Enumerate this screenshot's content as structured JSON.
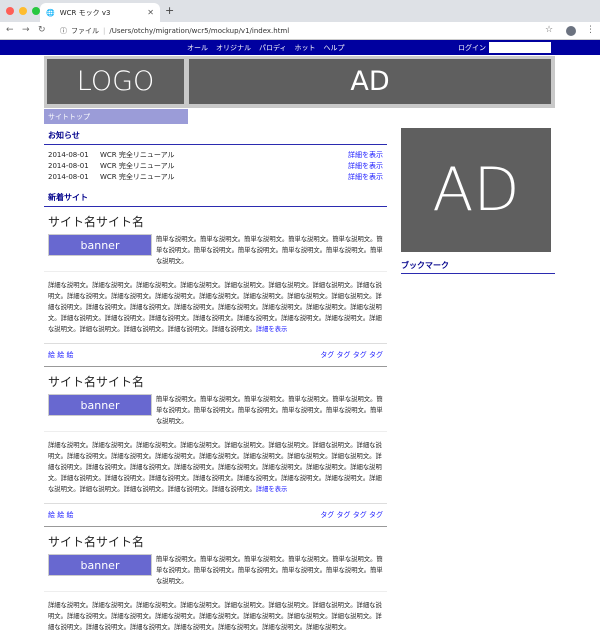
{
  "browser": {
    "tab_title": "WCR モック v3",
    "url_prefix": "ファイル",
    "url": "/Users/otchy/migration/wcr5/mockup/v1/index.html",
    "colors": {
      "red": "#ff5f57",
      "yellow": "#febc2e",
      "green": "#28c840"
    }
  },
  "nav": {
    "items": [
      "オール",
      "オリジナル",
      "パロディ",
      "ホット",
      "ヘルプ"
    ],
    "login": "ログイン"
  },
  "header": {
    "logo": "LOGO",
    "ad": "AD"
  },
  "breadcrumb": "サイトトップ",
  "news": {
    "title": "お知らせ",
    "rows": [
      {
        "date": "2014-08-01",
        "text": "WCR 完全リニューアル",
        "link": "詳細を表示"
      },
      {
        "date": "2014-08-01",
        "text": "WCR 完全リニューアル",
        "link": "詳細を表示"
      },
      {
        "date": "2014-08-01",
        "text": "WCR 完全リニューアル",
        "link": "詳細を表示"
      }
    ]
  },
  "new_sites": {
    "title": "新着サイト",
    "items": [
      {
        "name": "サイト名サイト名",
        "banner": "banner",
        "short": "簡単な説明文。簡単な説明文。簡単な説明文。簡単な説明文。簡単な説明文。簡単な説明文。簡単な説明文。簡単な説明文。簡単な説明文。簡単な説明文。簡単な説明文。",
        "long": "詳細な説明文。詳細な説明文。詳細な説明文。詳細な説明文。詳細な説明文。詳細な説明文。詳細な説明文。詳細な説明文。詳細な説明文。詳細な説明文。詳細な説明文。詳細な説明文。詳細な説明文。詳細な説明文。詳細な説明文。詳細な説明文。詳細な説明文。詳細な説明文。詳細な説明文。詳細な説明文。詳細な説明文。詳細な説明文。詳細な説明文。詳細な説明文。詳細な説明文。詳細な説明文。詳細な説明文。詳細な説明文。詳細な説明文。詳細な説明文。詳細な説明文。詳細な説明文。詳細な説明文。詳細な説明文。詳細な説明文。",
        "more": "詳細を表示",
        "pics": "絵 絵 絵",
        "tags": "タグ タグ タグ タグ"
      },
      {
        "name": "サイト名サイト名",
        "banner": "banner",
        "short": "簡単な説明文。簡単な説明文。簡単な説明文。簡単な説明文。簡単な説明文。簡単な説明文。簡単な説明文。簡単な説明文。簡単な説明文。簡単な説明文。簡単な説明文。",
        "long": "詳細な説明文。詳細な説明文。詳細な説明文。詳細な説明文。詳細な説明文。詳細な説明文。詳細な説明文。詳細な説明文。詳細な説明文。詳細な説明文。詳細な説明文。詳細な説明文。詳細な説明文。詳細な説明文。詳細な説明文。詳細な説明文。詳細な説明文。詳細な説明文。詳細な説明文。詳細な説明文。詳細な説明文。詳細な説明文。詳細な説明文。詳細な説明文。詳細な説明文。詳細な説明文。詳細な説明文。詳細な説明文。詳細な説明文。詳細な説明文。詳細な説明文。詳細な説明文。詳細な説明文。詳細な説明文。詳細な説明文。",
        "more": "詳細を表示",
        "pics": "絵 絵 絵",
        "tags": "タグ タグ タグ タグ"
      },
      {
        "name": "サイト名サイト名",
        "banner": "banner",
        "short": "簡単な説明文。簡単な説明文。簡単な説明文。簡単な説明文。簡単な説明文。簡単な説明文。簡単な説明文。簡単な説明文。簡単な説明文。簡単な説明文。簡単な説明文。",
        "long": "詳細な説明文。詳細な説明文。詳細な説明文。詳細な説明文。詳細な説明文。詳細な説明文。詳細な説明文。詳細な説明文。詳細な説明文。詳細な説明文。詳細な説明文。詳細な説明文。詳細な説明文。詳細な説明文。詳細な説明文。詳細な説明文。詳細な説明文。詳細な説明文。詳細な説明文。詳細な説明文。詳細な説明文。詳細な説明文。",
        "more": "",
        "pics": "",
        "tags": ""
      }
    ]
  },
  "sidebar": {
    "ad": "AD",
    "bookmark": "ブックマーク"
  }
}
